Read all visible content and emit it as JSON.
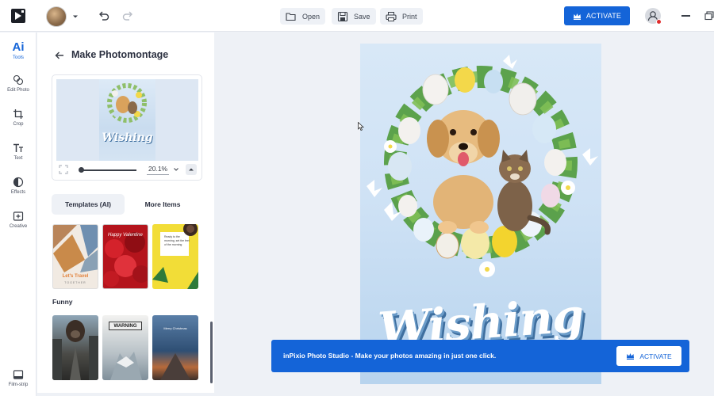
{
  "toolbar": {
    "open_label": "Open",
    "save_label": "Save",
    "print_label": "Print",
    "activate_label": "ACTIVATE"
  },
  "rail": {
    "items": [
      {
        "label": "Tools",
        "icon": "ai-icon"
      },
      {
        "label": "Edit Photo",
        "icon": "edit-photo-icon"
      },
      {
        "label": "Crop",
        "icon": "crop-icon"
      },
      {
        "label": "Text",
        "icon": "text-icon"
      },
      {
        "label": "Effects",
        "icon": "effects-icon"
      },
      {
        "label": "Creative",
        "icon": "creative-icon"
      },
      {
        "label": "Film-strip",
        "icon": "film-strip-icon"
      }
    ],
    "ai_glyph": "Ai"
  },
  "panel": {
    "title": "Make Photomontage",
    "preview_caption": "Wishing",
    "zoom": "20.1%",
    "tabs": [
      {
        "label": "Templates (AI)",
        "active": true
      },
      {
        "label": "More Items",
        "active": false
      }
    ],
    "section_funny": "Funny",
    "thumbs": {
      "t1_text": "Let's Travel",
      "t1_sub": "TOGETHER",
      "t2_text": "Happy Valentine",
      "t3_text": "Ready to the morning, set the feel of the morning",
      "t5_warn": "WARNING",
      "t6_text": "Merry Christmas"
    }
  },
  "canvas": {
    "headline": "Wishing"
  },
  "banner": {
    "text": "inPixio Photo Studio - Make your photos amazing in just one click.",
    "button_label": "ACTIVATE"
  },
  "colors": {
    "accent": "#1464d8",
    "background": "#eef1f6"
  }
}
